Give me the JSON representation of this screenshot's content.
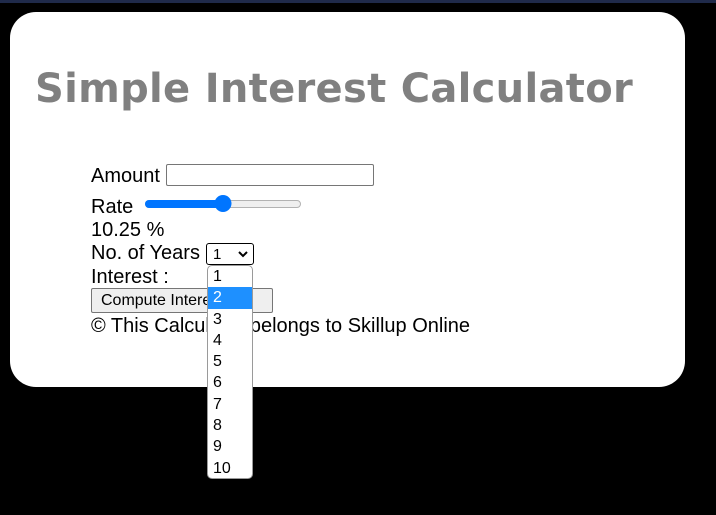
{
  "title": "Simple Interest Calculator",
  "form": {
    "amount_label": "Amount",
    "amount_value": "",
    "rate_label": "Rate",
    "rate_slider_fraction": 0.5,
    "rate_display": "10.25 %",
    "years_label": "No. of Years",
    "years_selected": "1",
    "years_highlighted": "2",
    "years_options": [
      "1",
      "2",
      "3",
      "4",
      "5",
      "6",
      "7",
      "8",
      "9",
      "10"
    ],
    "interest_label": "Interest :",
    "compute_button": "Compute Interest",
    "footer": "© This Calculator belongs to Skillup Online"
  },
  "colors": {
    "title": "#808080",
    "accent": "#0075ff",
    "option_highlight": "#1e90ff"
  }
}
